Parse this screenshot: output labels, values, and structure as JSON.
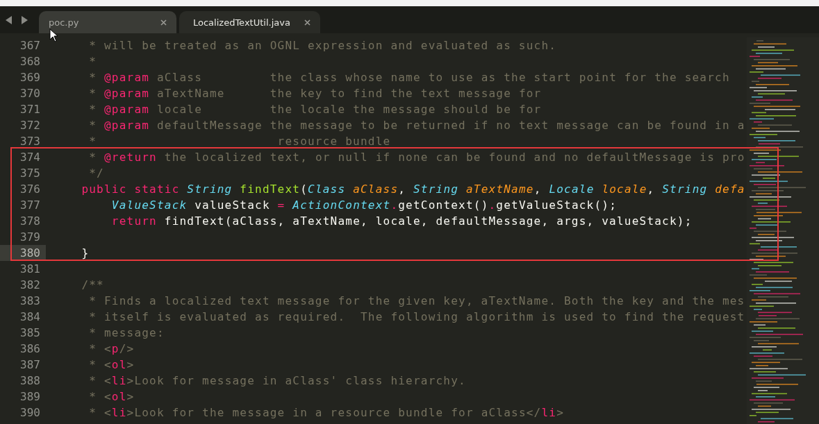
{
  "tabs": [
    {
      "label": "poc.py",
      "selected": false
    },
    {
      "label": "LocalizedTextUtil.java",
      "selected": true
    }
  ],
  "editor": {
    "lines": [
      {
        "number": "367",
        "current": false,
        "tokens": [
          {
            "kind": "comment",
            "text": "     * will be treated as an OGNL expression and evaluated as such."
          }
        ]
      },
      {
        "number": "368",
        "current": false,
        "tokens": [
          {
            "kind": "comment",
            "text": "     *"
          }
        ]
      },
      {
        "number": "369",
        "current": false,
        "tokens": [
          {
            "kind": "comment",
            "text": "     * "
          },
          {
            "kind": "tag",
            "text": "@param"
          },
          {
            "kind": "comment",
            "text": " aClass         the class whose name to use as the start point for the search"
          }
        ]
      },
      {
        "number": "370",
        "current": false,
        "tokens": [
          {
            "kind": "comment",
            "text": "     * "
          },
          {
            "kind": "tag",
            "text": "@param"
          },
          {
            "kind": "comment",
            "text": " aTextName      the key to find the text message for"
          }
        ]
      },
      {
        "number": "371",
        "current": false,
        "tokens": [
          {
            "kind": "comment",
            "text": "     * "
          },
          {
            "kind": "tag",
            "text": "@param"
          },
          {
            "kind": "comment",
            "text": " locale         the locale the message should be for"
          }
        ]
      },
      {
        "number": "372",
        "current": false,
        "tokens": [
          {
            "kind": "comment",
            "text": "     * "
          },
          {
            "kind": "tag",
            "text": "@param"
          },
          {
            "kind": "comment",
            "text": " defaultMessage the message to be returned if no text message can be found in a"
          }
        ]
      },
      {
        "number": "373",
        "current": false,
        "tokens": [
          {
            "kind": "comment",
            "text": "     *                        resource bundle"
          }
        ]
      },
      {
        "number": "374",
        "current": false,
        "tokens": [
          {
            "kind": "comment",
            "text": "     * "
          },
          {
            "kind": "tag",
            "text": "@return"
          },
          {
            "kind": "comment",
            "text": " the localized text, or null if none can be found and no defaultMessage is pro"
          }
        ]
      },
      {
        "number": "375",
        "current": false,
        "tokens": [
          {
            "kind": "comment",
            "text": "     */"
          }
        ]
      },
      {
        "number": "376",
        "current": false,
        "tokens": [
          {
            "kind": "keyword",
            "text": "    public static "
          },
          {
            "kind": "type",
            "text": "String "
          },
          {
            "kind": "function",
            "text": "findText"
          },
          {
            "kind": "plain",
            "text": "("
          },
          {
            "kind": "type",
            "text": "Class "
          },
          {
            "kind": "param",
            "text": "aClass"
          },
          {
            "kind": "plain",
            "text": ", "
          },
          {
            "kind": "type",
            "text": "String "
          },
          {
            "kind": "param",
            "text": "aTextName"
          },
          {
            "kind": "plain",
            "text": ", "
          },
          {
            "kind": "type",
            "text": "Locale "
          },
          {
            "kind": "param",
            "text": "locale"
          },
          {
            "kind": "plain",
            "text": ", "
          },
          {
            "kind": "type",
            "text": "String "
          },
          {
            "kind": "param",
            "text": "defa"
          }
        ]
      },
      {
        "number": "377",
        "current": false,
        "tokens": [
          {
            "kind": "type",
            "text": "        ValueStack"
          },
          {
            "kind": "plain",
            "text": " valueStack "
          },
          {
            "kind": "operator",
            "text": "= "
          },
          {
            "kind": "type",
            "text": "ActionContext"
          },
          {
            "kind": "operator",
            "text": "."
          },
          {
            "kind": "plain",
            "text": "getContext()"
          },
          {
            "kind": "operator",
            "text": "."
          },
          {
            "kind": "plain",
            "text": "getValueStack();"
          }
        ]
      },
      {
        "number": "378",
        "current": false,
        "tokens": [
          {
            "kind": "keyword",
            "text": "        return"
          },
          {
            "kind": "plain",
            "text": " findText(aClass, aTextName, locale, defaultMessage, args, valueStack);"
          }
        ]
      },
      {
        "number": "379",
        "current": false
      },
      {
        "number": "380",
        "current": true,
        "tokens": [
          {
            "kind": "plain",
            "text": "    }"
          }
        ]
      },
      {
        "number": "381",
        "current": false
      },
      {
        "number": "382",
        "current": false,
        "tokens": [
          {
            "kind": "comment",
            "text": "    /**"
          }
        ]
      },
      {
        "number": "383",
        "current": false,
        "tokens": [
          {
            "kind": "comment",
            "text": "     * Finds a localized text message for the given key, aTextName. Both the key and the mes"
          }
        ]
      },
      {
        "number": "384",
        "current": false,
        "tokens": [
          {
            "kind": "comment",
            "text": "     * itself is evaluated as required.  The following algorithm is used to find the request"
          }
        ]
      },
      {
        "number": "385",
        "current": false,
        "tokens": [
          {
            "kind": "comment",
            "text": "     * message:"
          }
        ]
      },
      {
        "number": "386",
        "current": false,
        "tokens": [
          {
            "kind": "comment",
            "text": "     * <"
          },
          {
            "kind": "tag",
            "text": "p"
          },
          {
            "kind": "comment",
            "text": "/>"
          }
        ]
      },
      {
        "number": "387",
        "current": false,
        "tokens": [
          {
            "kind": "comment",
            "text": "     * <"
          },
          {
            "kind": "tag",
            "text": "ol"
          },
          {
            "kind": "comment",
            "text": ">"
          }
        ]
      },
      {
        "number": "388",
        "current": false,
        "tokens": [
          {
            "kind": "comment",
            "text": "     * <"
          },
          {
            "kind": "tag",
            "text": "li"
          },
          {
            "kind": "comment",
            "text": ">Look for message in aClass' class hierarchy."
          }
        ]
      },
      {
        "number": "389",
        "current": false,
        "tokens": [
          {
            "kind": "comment",
            "text": "     * <"
          },
          {
            "kind": "tag",
            "text": "ol"
          },
          {
            "kind": "comment",
            "text": ">"
          }
        ]
      },
      {
        "number": "390",
        "current": false,
        "tokens": [
          {
            "kind": "comment",
            "text": "     * <"
          },
          {
            "kind": "tag",
            "text": "li"
          },
          {
            "kind": "comment",
            "text": ">Look for the message in a resource bundle for aClass</"
          },
          {
            "kind": "tag",
            "text": "li"
          },
          {
            "kind": "comment",
            "text": ">"
          }
        ]
      }
    ]
  }
}
